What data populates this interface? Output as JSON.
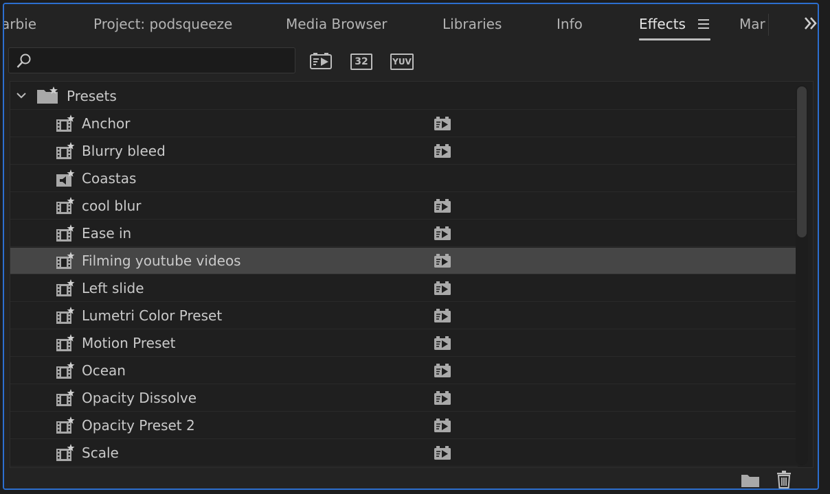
{
  "tabs": [
    {
      "label": "arbie",
      "active": false
    },
    {
      "label": "Project: podsqueeze",
      "active": false
    },
    {
      "label": "Media Browser",
      "active": false
    },
    {
      "label": "Libraries",
      "active": false
    },
    {
      "label": "Info",
      "active": false
    },
    {
      "label": "Effects",
      "active": true
    },
    {
      "label": "Mar",
      "active": false
    }
  ],
  "search": {
    "value": "",
    "placeholder": ""
  },
  "toolbar": {
    "accelerated_icon": "accelerated-effects-icon",
    "badge_32": "32",
    "badge_yuv": "YUV"
  },
  "folder": {
    "label": "Presets",
    "expanded": true
  },
  "presets": [
    {
      "label": "Anchor",
      "accelerated": true,
      "selected": false
    },
    {
      "label": "Blurry bleed",
      "accelerated": true,
      "selected": false
    },
    {
      "label": "Coastas",
      "accelerated": false,
      "selected": false,
      "audio": true
    },
    {
      "label": "cool blur",
      "accelerated": true,
      "selected": false
    },
    {
      "label": "Ease in",
      "accelerated": true,
      "selected": false
    },
    {
      "label": "Filming youtube videos",
      "accelerated": true,
      "selected": true
    },
    {
      "label": "Left slide",
      "accelerated": true,
      "selected": false
    },
    {
      "label": "Lumetri Color Preset",
      "accelerated": true,
      "selected": false
    },
    {
      "label": "Motion Preset",
      "accelerated": true,
      "selected": false
    },
    {
      "label": "Ocean",
      "accelerated": true,
      "selected": false
    },
    {
      "label": "Opacity Dissolve",
      "accelerated": true,
      "selected": false
    },
    {
      "label": "Opacity Preset 2",
      "accelerated": true,
      "selected": false
    },
    {
      "label": "Scale",
      "accelerated": true,
      "selected": false
    }
  ],
  "colors": {
    "accent_border": "#2c6fd0",
    "selected_row": "#464646",
    "panel_bg": "#232323"
  }
}
